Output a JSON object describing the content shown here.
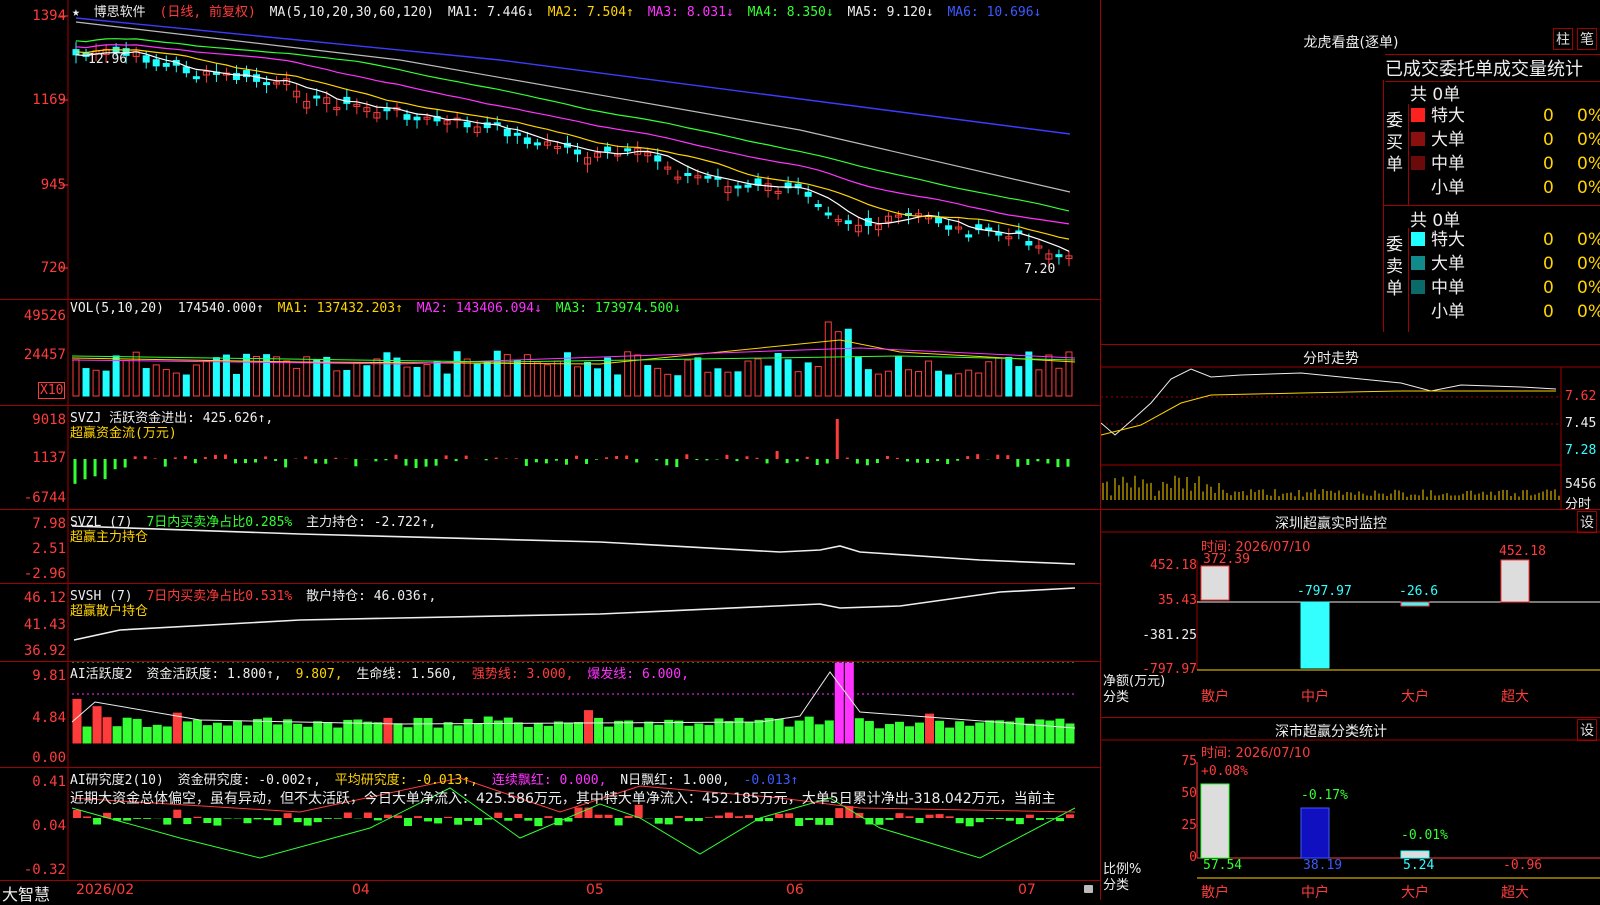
{
  "header": {
    "star": "★",
    "name": "博思软件",
    "period": "(日线, 前复权)",
    "ma_label": "MA(5,10,20,30,60,120)",
    "ma1": "MA1: 7.446↓",
    "ma2": "MA2: 7.504↑",
    "ma3": "MA3: 8.031↓",
    "ma4": "MA4: 8.350↓",
    "ma5": "MA5: 9.120↓",
    "ma6": "MA6: 10.696↓"
  },
  "price_axis": [
    "1394",
    "1169",
    "945",
    "720"
  ],
  "price_marks": {
    "high": "12.96",
    "low": "7.20"
  },
  "vol": {
    "label": "VOL(5,10,20)",
    "value": "174540.000↑",
    "ma1": "MA1: 137432.203↑",
    "ma2": "MA2: 143406.094↓",
    "ma3": "MA3: 173974.500↓",
    "axis": [
      "49526",
      "24457"
    ],
    "unit": "X10"
  },
  "svzj": {
    "line1": "SVZJ  活跃资金进出: 425.626↑,",
    "line2": "超赢资金流(万元)",
    "axis": [
      "9018",
      "1137",
      "-6744"
    ]
  },
  "svzl": {
    "a": "SVZL (7)",
    "b": "7日内买卖净占比0.285%",
    "c": "主力持仓: -2.722↑,",
    "line2": "超赢主力持仓",
    "axis": [
      "7.98",
      "2.51",
      "-2.96"
    ]
  },
  "svsh": {
    "a": "SVSH (7)",
    "b": "7日内买卖净占比0.531%",
    "c": "散户持仓: 46.036↑,",
    "line2": "超赢散户持仓",
    "axis": [
      "46.12",
      "41.43",
      "36.92"
    ]
  },
  "ai1": {
    "a": "AI活跃度2",
    "b": "资金活跃度: 1.800↑,",
    "c": "9.807,",
    "d": "生命线: 1.560,",
    "e": "强势线: 3.000,",
    "f": "爆发线: 6.000,",
    "axis": [
      "9.81",
      "4.84",
      "0.00"
    ]
  },
  "ai2": {
    "a": "AI研究度2(10)",
    "b": "资金研究度: -0.002↑,",
    "c": "平均研究度: -0.013↑,",
    "d": "连续飘红: 0.000,",
    "e": "N日飘红: 1.000,",
    "f": "-0.013↑",
    "text": "近期大资金总体偏空，虽有异动，但不太活跃，今日大单净流入：425.586万元，其中特大单净流入：452.185万元，大单5日累计净出-318.042万元，当前主",
    "axis": [
      "0.41",
      "0.04",
      "-0.32"
    ]
  },
  "footer": {
    "brand": "大智慧",
    "dates": [
      "2026/02",
      "04",
      "05",
      "06",
      "07"
    ]
  },
  "lhkp": {
    "title": "龙虎看盘(逐单)",
    "btn1": "柱",
    "btn2": "笔",
    "subtitle": "已成交委托单成交量统计",
    "buy_group": "委买单",
    "sell_group": "委卖单",
    "buy_total": "共 0单",
    "sell_total": "共 0单",
    "rows": [
      {
        "name": "特大",
        "count": "0",
        "pct": "0%"
      },
      {
        "name": "大单",
        "count": "0",
        "pct": "0%"
      },
      {
        "name": "中单",
        "count": "0",
        "pct": "0%"
      },
      {
        "name": "小单",
        "count": "0",
        "pct": "0%"
      }
    ]
  },
  "fenshi": {
    "title": "分时走势",
    "axis": [
      "7.62",
      "7.45",
      "7.28"
    ],
    "vol_max": "5456",
    "vol_label": "分时"
  },
  "monitor": {
    "title": "深圳超赢实时监控",
    "btn": "设",
    "time": "时间: 2026/07/10",
    "axis": [
      "452.18",
      "35.43",
      "-381.25",
      "-797.97"
    ],
    "ylabel": "净额(万元)",
    "xlabel": "分类",
    "cats": [
      "散户",
      "中户",
      "大户",
      "超大"
    ],
    "values": [
      "372.39",
      "-797.97",
      "-26.6",
      "452.18"
    ]
  },
  "classify": {
    "title": "深市超赢分类统计",
    "btn": "设",
    "time": "时间: 2026/07/10",
    "axis": [
      "75",
      "50",
      "25",
      "0"
    ],
    "ylabel": "比例%",
    "xlabel": "分类",
    "cats": [
      "散户",
      "中户",
      "大户",
      "超大"
    ],
    "changes": [
      "+0.08%",
      "-0.17%",
      "-0.01%",
      ""
    ],
    "values": [
      "57.54",
      "38.19",
      "5.24",
      "-0.96"
    ]
  }
}
